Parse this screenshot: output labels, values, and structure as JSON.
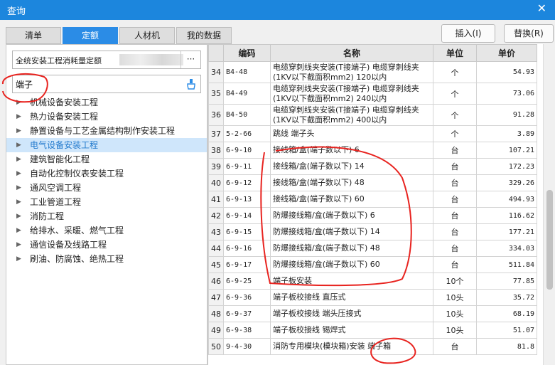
{
  "window": {
    "title": "查询",
    "close_glyph": "✕"
  },
  "tabs": [
    {
      "label": "清单",
      "active": false
    },
    {
      "label": "定额",
      "active": true
    },
    {
      "label": "人材机",
      "active": false
    },
    {
      "label": "我的数据",
      "active": false
    }
  ],
  "toolbar": {
    "insert_label": "插入(I)",
    "replace_label": "替换(R)"
  },
  "quota_selector": {
    "value": "全统安装工程消耗量定额",
    "more_label": "···"
  },
  "search": {
    "value": "端子",
    "icon": "clear-brush-icon"
  },
  "tree": {
    "items": [
      {
        "label": "机械设备安装工程",
        "selected": false
      },
      {
        "label": "热力设备安装工程",
        "selected": false
      },
      {
        "label": "静置设备与工艺金属结构制作安装工程",
        "selected": false
      },
      {
        "label": "电气设备安装工程",
        "selected": true
      },
      {
        "label": "建筑智能化工程",
        "selected": false
      },
      {
        "label": "自动化控制仪表安装工程",
        "selected": false
      },
      {
        "label": "通风空调工程",
        "selected": false
      },
      {
        "label": "工业管道工程",
        "selected": false
      },
      {
        "label": "消防工程",
        "selected": false
      },
      {
        "label": "给排水、采暖、燃气工程",
        "selected": false
      },
      {
        "label": "通信设备及线路工程",
        "selected": false
      },
      {
        "label": "刷油、防腐蚀、绝热工程",
        "selected": false
      }
    ]
  },
  "table": {
    "headers": {
      "num": "",
      "code": "编码",
      "name": "名称",
      "unit": "单位",
      "price": "单价"
    },
    "rows": [
      {
        "num": "34",
        "code": "B4-48",
        "name": "电缆穿刺线夹安装(T接端子) 电缆穿刺线夹(1KV以下截面积mm2) 120以内",
        "unit": "个",
        "price": "54.93"
      },
      {
        "num": "35",
        "code": "B4-49",
        "name": "电缆穿刺线夹安装(T接端子) 电缆穿刺线夹(1KV以下截面积mm2) 240以内",
        "unit": "个",
        "price": "73.06"
      },
      {
        "num": "36",
        "code": "B4-50",
        "name": "电缆穿刺线夹安装(T接端子) 电缆穿刺线夹(1KV以下截面积mm2) 400以内",
        "unit": "个",
        "price": "91.28"
      },
      {
        "num": "37",
        "code": "5-2-66",
        "name": "跳线 端子头",
        "unit": "个",
        "price": "3.89"
      },
      {
        "num": "38",
        "code": "6-9-10",
        "name": "接线箱/盒(端子数以下) 6",
        "unit": "台",
        "price": "107.21"
      },
      {
        "num": "39",
        "code": "6-9-11",
        "name": "接线箱/盒(端子数以下) 14",
        "unit": "台",
        "price": "172.23"
      },
      {
        "num": "40",
        "code": "6-9-12",
        "name": "接线箱/盒(端子数以下) 48",
        "unit": "台",
        "price": "329.26"
      },
      {
        "num": "41",
        "code": "6-9-13",
        "name": "接线箱/盒(端子数以下) 60",
        "unit": "台",
        "price": "494.93"
      },
      {
        "num": "42",
        "code": "6-9-14",
        "name": "防爆接线箱/盒(端子数以下) 6",
        "unit": "台",
        "price": "116.62"
      },
      {
        "num": "43",
        "code": "6-9-15",
        "name": "防爆接线箱/盒(端子数以下) 14",
        "unit": "台",
        "price": "177.21"
      },
      {
        "num": "44",
        "code": "6-9-16",
        "name": "防爆接线箱/盒(端子数以下) 48",
        "unit": "台",
        "price": "334.03"
      },
      {
        "num": "45",
        "code": "6-9-17",
        "name": "防爆接线箱/盒(端子数以下) 60",
        "unit": "台",
        "price": "511.84"
      },
      {
        "num": "46",
        "code": "6-9-25",
        "name": "端子板安装",
        "unit": "10个",
        "price": "77.85"
      },
      {
        "num": "47",
        "code": "6-9-36",
        "name": "端子板校接线 直压式",
        "unit": "10头",
        "price": "35.72"
      },
      {
        "num": "48",
        "code": "6-9-37",
        "name": "端子板校接线 端头压接式",
        "unit": "10头",
        "price": "68.19"
      },
      {
        "num": "49",
        "code": "6-9-38",
        "name": "端子板校接线 锡焊式",
        "unit": "10头",
        "price": "51.07"
      },
      {
        "num": "50",
        "code": "9-4-30",
        "name": "消防专用模块(模块箱)安装 端子箱",
        "unit": "台",
        "price": "81.8"
      }
    ]
  },
  "colors": {
    "accent": "#2b8ce6",
    "titlebar": "#1c86dd",
    "annotation": "#e8231f",
    "selected_row": "#cfe6fb"
  }
}
